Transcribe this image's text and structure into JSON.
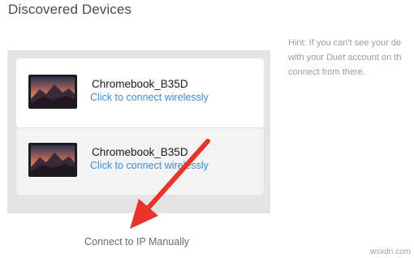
{
  "page": {
    "title": "Discovered Devices"
  },
  "devices": [
    {
      "name": "Chromebook_B35D",
      "action": "Click to connect wirelessly",
      "icon": "laptop-thumbnail-icon"
    },
    {
      "name": "Chromebook_B35D",
      "action": "Click to connect wirelessly",
      "icon": "laptop-thumbnail-icon"
    }
  ],
  "hint": {
    "lines": [
      "Hint: If you can't see your de",
      "with your Duet account on th",
      "connect from there."
    ]
  },
  "footer": {
    "connect_ip_label": "Connect to IP Manually"
  },
  "annotation": {
    "arrow_color": "#e8342a",
    "icon": "red-arrow-icon"
  },
  "watermark": "wsxdn.com",
  "colors": {
    "link": "#3f8dd0",
    "panel_bg": "#e3e3e3",
    "title_text": "#4a4a4a"
  }
}
